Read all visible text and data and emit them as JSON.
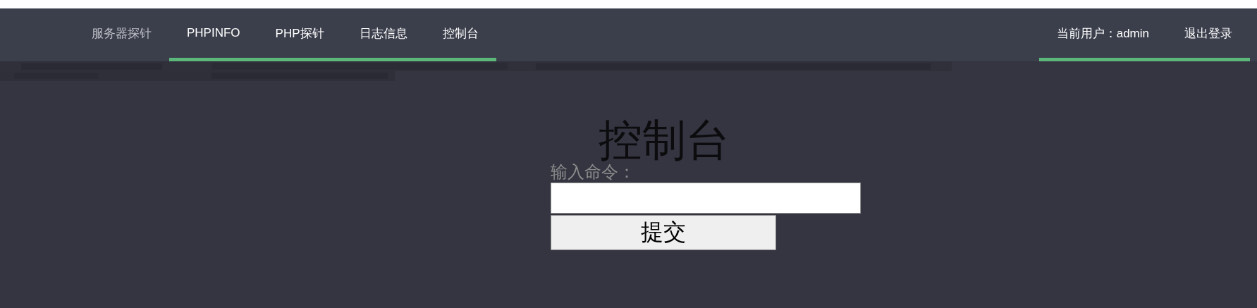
{
  "nav": {
    "items": [
      {
        "label": "服务器探针",
        "muted": true,
        "underlined": false
      },
      {
        "label": "PHPINFO",
        "muted": false,
        "underlined": true
      },
      {
        "label": "PHP探针",
        "muted": false,
        "underlined": true
      },
      {
        "label": "日志信息",
        "muted": false,
        "underlined": true
      },
      {
        "label": "控制台",
        "muted": false,
        "underlined": true
      }
    ],
    "user_items": [
      {
        "label": "当前用户：admin",
        "underlined": true
      },
      {
        "label": "退出登录",
        "underlined": true
      }
    ]
  },
  "page": {
    "title": "控制台",
    "form": {
      "label": "输入命令：",
      "submit": "提交"
    }
  }
}
